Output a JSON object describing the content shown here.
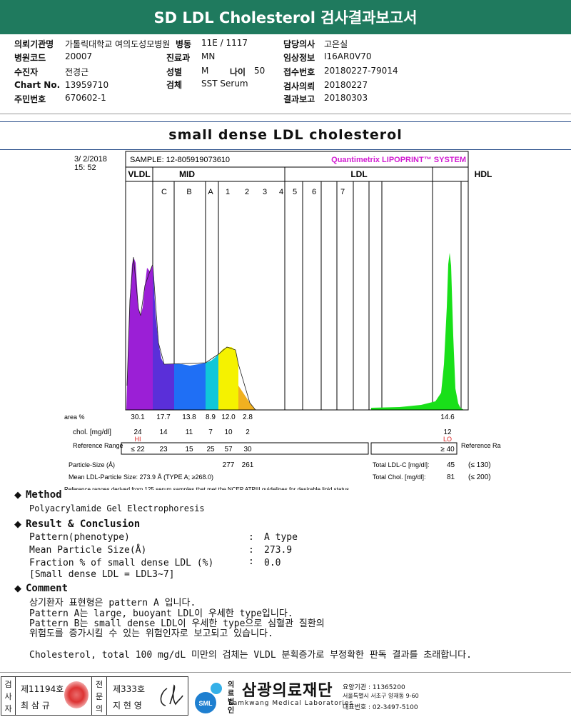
{
  "title": "SD LDL Cholesterol 검사결과보고서",
  "header": {
    "col1": [
      {
        "k": "의뢰기관명",
        "v": "가톨릭대학교 여의도성모병원"
      },
      {
        "k": "병원코드",
        "v": "20007"
      },
      {
        "k": "수진자",
        "v": "전경근"
      },
      {
        "k": "Chart No.",
        "v": "13959710"
      },
      {
        "k": "주민번호",
        "v": "670602-1"
      }
    ],
    "col2": [
      {
        "k": "병동",
        "v": "11E / 1117"
      },
      {
        "k": "진료과",
        "v": "MN"
      },
      {
        "k": "성별",
        "v": "M"
      },
      {
        "k": "검체",
        "v": "SST Serum"
      }
    ],
    "age_label": "나이",
    "age_value": "50",
    "col3": [
      {
        "k": "담당의사",
        "v": "고은실"
      },
      {
        "k": "임상정보",
        "v": "I16AR0V70"
      },
      {
        "k": "접수번호",
        "v": "20180227-79014"
      },
      {
        "k": "검사의뢰",
        "v": "20180227"
      },
      {
        "k": "결과보고",
        "v": "20180303"
      }
    ]
  },
  "subtitle": "small dense LDL cholesterol",
  "chart_data": {
    "type": "area",
    "datetime": "3/ 2/2018 15: 52",
    "sample": "SAMPLE:  12-805919073610",
    "brand": "Quantimetrix LIPOPRINT™ SYSTEM",
    "groups": [
      "VLDL",
      "MID",
      "LDL",
      "HDL"
    ],
    "bands": [
      "C",
      "B",
      "A",
      "1",
      "2",
      "3",
      "4",
      "5",
      "6",
      "7"
    ],
    "fractions": [
      "VLDL",
      "C",
      "B",
      "A",
      "1",
      "2",
      "HDL"
    ],
    "colors": {
      "VLDL": "#9b1fd6",
      "C": "#5a2fd9",
      "B": "#1f6ff5",
      "A": "#10c7d9",
      "1": "#f5f200",
      "2": "#f0b020",
      "HDL": "#19e019"
    },
    "area_label": "area %",
    "area": [
      "30.1",
      "17.7",
      "13.8",
      "8.9",
      "12.0",
      "2.8",
      "14.6"
    ],
    "chol_label": "chol. [mg/dl]",
    "chol": [
      "24",
      "14",
      "11",
      "7",
      "10",
      "2",
      "12"
    ],
    "flags": {
      "VLDL": "HI",
      "HDL": "LO"
    },
    "ref_label_left": "Reference Range",
    "ref_label_right": "Reference Range",
    "ref": [
      "≤ 22",
      "23",
      "15",
      "25",
      "57",
      "30",
      "≥ 40"
    ],
    "particle_label": "Particle-Size (Å)",
    "particle": [
      "277",
      "261"
    ],
    "mean_size_text": "Mean LDL-Particle Size:  273.9 Å  (TYPE A; ≥268.0)",
    "total_ldl_label": "Total LDL-C [mg/dl]:",
    "total_ldl_value": "45",
    "total_ldl_ref": "(≤ 130)",
    "total_chol_label": "Total Chol. [mg/dl]:",
    "total_chol_value": "81",
    "total_chol_ref": "(≤ 200)",
    "footnote": "Reference ranges derived from 125 serum samples that met the NCEP ATPIII guidelines for desirable lipid status"
  },
  "method": {
    "heading": "Method",
    "text": "Polyacrylamide Gel Electrophoresis"
  },
  "result": {
    "heading": "Result & Conclusion",
    "rows": [
      {
        "k": "Pattern(phenotype)",
        "v": "A type"
      },
      {
        "k": "Mean Particle Size(Å)",
        "v": "273.9"
      },
      {
        "k": "Fraction % of small dense LDL (%)",
        "v": "0.0"
      }
    ],
    "note": "[Small dense LDL = LDL3~7]"
  },
  "comment": {
    "heading": "Comment",
    "lines": [
      "상기환자 표현형은 pattern A 입니다.",
      "Pattern A는 large, buoyant LDL이 우세한 type입니다.",
      "Pattern B는 small dense LDL이 우세한 type으로 심혈관 질환의",
      "위험도를 증가시킬 수 있는 위험인자로 보고되고 있습니다."
    ],
    "note": "Cholesterol, total 100 mg/dL 미만의 검체는 VLDL 분획증가로 부정확한 판독 결과를 초래합니다."
  },
  "footer": {
    "tester_label": "검사자",
    "tester_id": "제11194호",
    "tester_name": "최 삼 규",
    "specialist_label": "전문의",
    "specialist_id": "제333호",
    "specialist_name": "지 현 영",
    "org_prefix": "의료법인",
    "org_name": "삼광의료재단",
    "org_en": "Samkwang Medical Laboratories",
    "logo_text": "SML",
    "info1": "요양기관 : 11365200",
    "info2": "서울특별시 서초구 양재동 9-60",
    "info3": "대표번호 : 02-3497-5100"
  }
}
